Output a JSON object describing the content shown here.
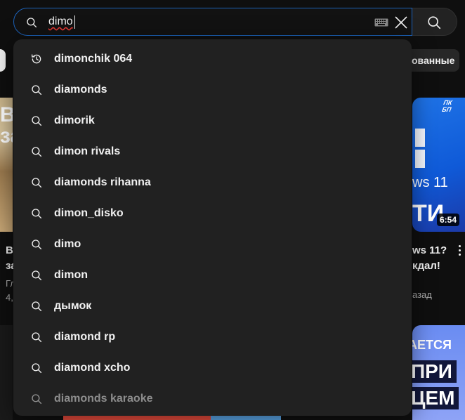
{
  "search": {
    "query": "dimo",
    "icons": {
      "lead": "search-icon",
      "keyboard": "keyboard-icon",
      "clear": "close-icon",
      "submit": "search-icon"
    }
  },
  "suggestions": [
    {
      "text": "dimonchik 064",
      "icon": "history-icon"
    },
    {
      "text": "diamonds",
      "icon": "search-icon"
    },
    {
      "text": "dimorik",
      "icon": "search-icon"
    },
    {
      "text": "dimon rivals",
      "icon": "search-icon"
    },
    {
      "text": "diamonds rihanna",
      "icon": "search-icon"
    },
    {
      "text": "dimon_disko",
      "icon": "search-icon"
    },
    {
      "text": "dimo",
      "icon": "search-icon"
    },
    {
      "text": "dimon",
      "icon": "search-icon"
    },
    {
      "text": "дымок",
      "icon": "search-icon"
    },
    {
      "text": "diamond rp",
      "icon": "search-icon"
    },
    {
      "text": "diamond xcho",
      "icon": "search-icon"
    },
    {
      "text": "diamonds karaoke",
      "icon": "search-icon"
    }
  ],
  "background": {
    "chip_right": "ованные",
    "left_thumb": {
      "line1": "В",
      "line2": "за"
    },
    "left_title": [
      "В",
      "за"
    ],
    "left_meta": [
      "Гл",
      "4,"
    ],
    "right_thumb": {
      "badge": "ПК БП",
      "text1": "ws 11",
      "text2": "ТИ"
    },
    "duration": "6:54",
    "right_title": [
      "ws 11?",
      "кдал!"
    ],
    "right_meta": "азад",
    "br_thumb": {
      "l1": "АЕТСЯ",
      "l2": "ПРИ",
      "l3": "ЦЕМ"
    }
  },
  "colors": {
    "page_bg": "#0f0f0f",
    "dropdown_bg": "#212121",
    "focus_border": "#1c62b9",
    "text": "#f1f1f1"
  }
}
